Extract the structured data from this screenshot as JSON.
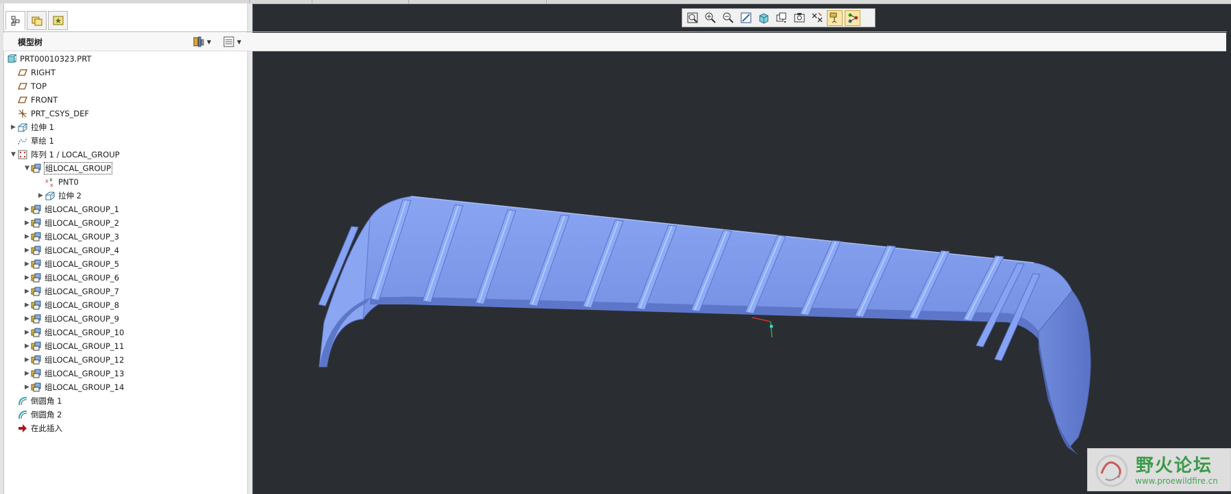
{
  "panel": {
    "title": "模型树",
    "tabs": [
      "model-tree-tab",
      "layers-tab",
      "favorites-tab"
    ]
  },
  "tree": {
    "root": "PRT00010323.PRT",
    "items": [
      {
        "label": "RIGHT",
        "icon": "datum-plane-icon",
        "depth": 1,
        "expand": ""
      },
      {
        "label": "TOP",
        "icon": "datum-plane-icon",
        "depth": 1,
        "expand": ""
      },
      {
        "label": "FRONT",
        "icon": "datum-plane-icon",
        "depth": 1,
        "expand": ""
      },
      {
        "label": "PRT_CSYS_DEF",
        "icon": "coordinate-system-icon",
        "depth": 1,
        "expand": ""
      },
      {
        "label": "拉伸 1",
        "icon": "extrude-icon",
        "depth": 1,
        "expand": "▶"
      },
      {
        "label": "草绘 1",
        "icon": "sketch-icon",
        "depth": 1,
        "expand": ""
      },
      {
        "label": "阵列 1 / LOCAL_GROUP",
        "icon": "pattern-icon",
        "depth": 1,
        "expand": "▼"
      },
      {
        "label": "组LOCAL_GROUP",
        "icon": "group-icon",
        "depth": 2,
        "expand": "▼",
        "selected": true
      },
      {
        "label": "PNT0",
        "icon": "datum-point-icon",
        "depth": 3,
        "expand": ""
      },
      {
        "label": "拉伸 2",
        "icon": "extrude-icon",
        "depth": 3,
        "expand": "▶"
      },
      {
        "label": "组LOCAL_GROUP_1",
        "icon": "group-icon",
        "depth": 2,
        "expand": "▶"
      },
      {
        "label": "组LOCAL_GROUP_2",
        "icon": "group-icon",
        "depth": 2,
        "expand": "▶"
      },
      {
        "label": "组LOCAL_GROUP_3",
        "icon": "group-icon",
        "depth": 2,
        "expand": "▶"
      },
      {
        "label": "组LOCAL_GROUP_4",
        "icon": "group-icon",
        "depth": 2,
        "expand": "▶"
      },
      {
        "label": "组LOCAL_GROUP_5",
        "icon": "group-icon",
        "depth": 2,
        "expand": "▶"
      },
      {
        "label": "组LOCAL_GROUP_6",
        "icon": "group-icon",
        "depth": 2,
        "expand": "▶"
      },
      {
        "label": "组LOCAL_GROUP_7",
        "icon": "group-icon",
        "depth": 2,
        "expand": "▶"
      },
      {
        "label": "组LOCAL_GROUP_8",
        "icon": "group-icon",
        "depth": 2,
        "expand": "▶"
      },
      {
        "label": "组LOCAL_GROUP_9",
        "icon": "group-icon",
        "depth": 2,
        "expand": "▶"
      },
      {
        "label": "组LOCAL_GROUP_10",
        "icon": "group-icon",
        "depth": 2,
        "expand": "▶"
      },
      {
        "label": "组LOCAL_GROUP_11",
        "icon": "group-icon",
        "depth": 2,
        "expand": "▶"
      },
      {
        "label": "组LOCAL_GROUP_12",
        "icon": "group-icon",
        "depth": 2,
        "expand": "▶"
      },
      {
        "label": "组LOCAL_GROUP_13",
        "icon": "group-icon",
        "depth": 2,
        "expand": "▶"
      },
      {
        "label": "组LOCAL_GROUP_14",
        "icon": "group-icon",
        "depth": 2,
        "expand": "▶"
      },
      {
        "label": "倒圆角 1",
        "icon": "round-icon",
        "depth": 1,
        "expand": ""
      },
      {
        "label": "倒圆角 2",
        "icon": "round-icon",
        "depth": 1,
        "expand": ""
      },
      {
        "label": "在此插入",
        "icon": "insert-here-icon",
        "depth": 1,
        "expand": ""
      }
    ]
  },
  "toolbar": {
    "buttons": [
      {
        "name": "refit-icon",
        "active": false
      },
      {
        "name": "zoom-in-icon",
        "active": false
      },
      {
        "name": "zoom-out-icon",
        "active": false
      },
      {
        "name": "repaint-icon",
        "active": false
      },
      {
        "name": "display-style-icon",
        "active": false
      },
      {
        "name": "saved-views-icon",
        "active": false
      },
      {
        "name": "view-manager-icon",
        "active": false
      },
      {
        "name": "datum-display-icon",
        "active": false
      },
      {
        "name": "annotation-display-icon",
        "active": true
      },
      {
        "name": "spin-center-icon",
        "active": true
      }
    ]
  },
  "watermark": {
    "title": "野火论坛",
    "url": "www.proewildfire.cn"
  },
  "colors": {
    "viewport_bg": "#2a2e33",
    "model_body": "#7e9bec",
    "model_dark": "#4f68b8",
    "selection": "#fbe7a6"
  }
}
